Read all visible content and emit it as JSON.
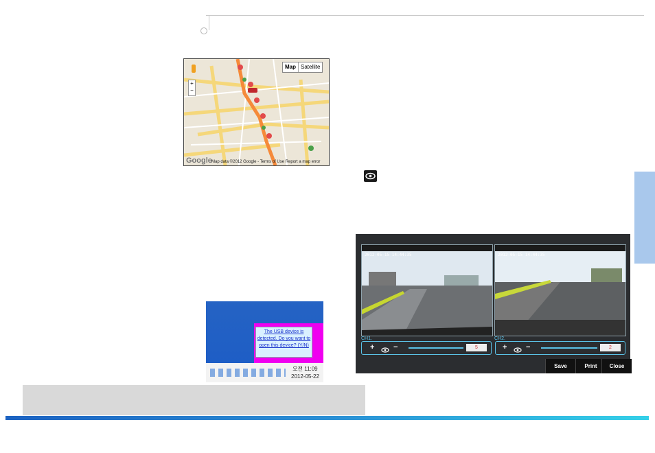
{
  "map": {
    "view_map": "Map",
    "view_satellite": "Satellite",
    "footer": "Map data ©2012 Google - Terms of Use   Report a map error",
    "logo": "Google",
    "zoom_plus": "+",
    "zoom_minus": "−"
  },
  "eye_icon": "eye-icon",
  "viewer": {
    "ch1": {
      "label": "CH1.",
      "timestamp": "2012-05-15 14:44:35",
      "value": "5"
    },
    "ch2": {
      "label": "CH2.",
      "timestamp": "2012-05-15 14:44:35",
      "value": "2"
    },
    "buttons": {
      "save": "Save",
      "print": "Print",
      "close": "Close"
    },
    "plus": "+",
    "minus": "−"
  },
  "tray": {
    "popup": "The USB device is detected. Do you want to open this device? (Y/N)",
    "time": "오전 11:09",
    "date": "2012-05-22"
  },
  "colors": {
    "side_tab": "#a9c8ec",
    "accent": "#5bc2e7",
    "note_box": "#d9d9d9"
  }
}
